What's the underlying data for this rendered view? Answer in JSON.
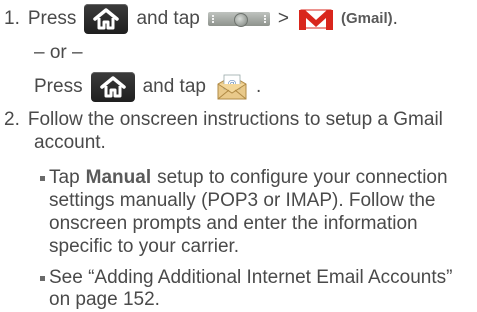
{
  "step1": {
    "number": "1.",
    "press": "Press",
    "and_tap": "and tap",
    "gt": ">",
    "gmail_label": "(Gmail)",
    "period": "."
  },
  "or_line": "– or –",
  "alt": {
    "press": "Press",
    "and_tap": "and tap",
    "period": "."
  },
  "step2": {
    "number": "2.",
    "lines": [
      "Follow the onscreen instructions to setup a Gmail",
      "account."
    ]
  },
  "bullet1": {
    "tap": "Tap",
    "manual": "Manual",
    "line1_rest": "setup to configure your connection",
    "lines": [
      "settings manually (POP3 or IMAP). Follow the",
      "onscreen prompts and enter the information",
      "specific to your carrier."
    ]
  },
  "bullet2": {
    "lines": [
      "See “Adding Additional Internet Email Accounts”",
      "on page 152."
    ]
  },
  "icons": {
    "home": "home-icon",
    "launcher": "launcher-bar-icon",
    "gmail": "gmail-icon",
    "email": "email-envelope-icon"
  },
  "colors": {
    "text": "#4a4a4a",
    "gmail_red": "#d9261c",
    "home_button": "#2a2a2a"
  }
}
